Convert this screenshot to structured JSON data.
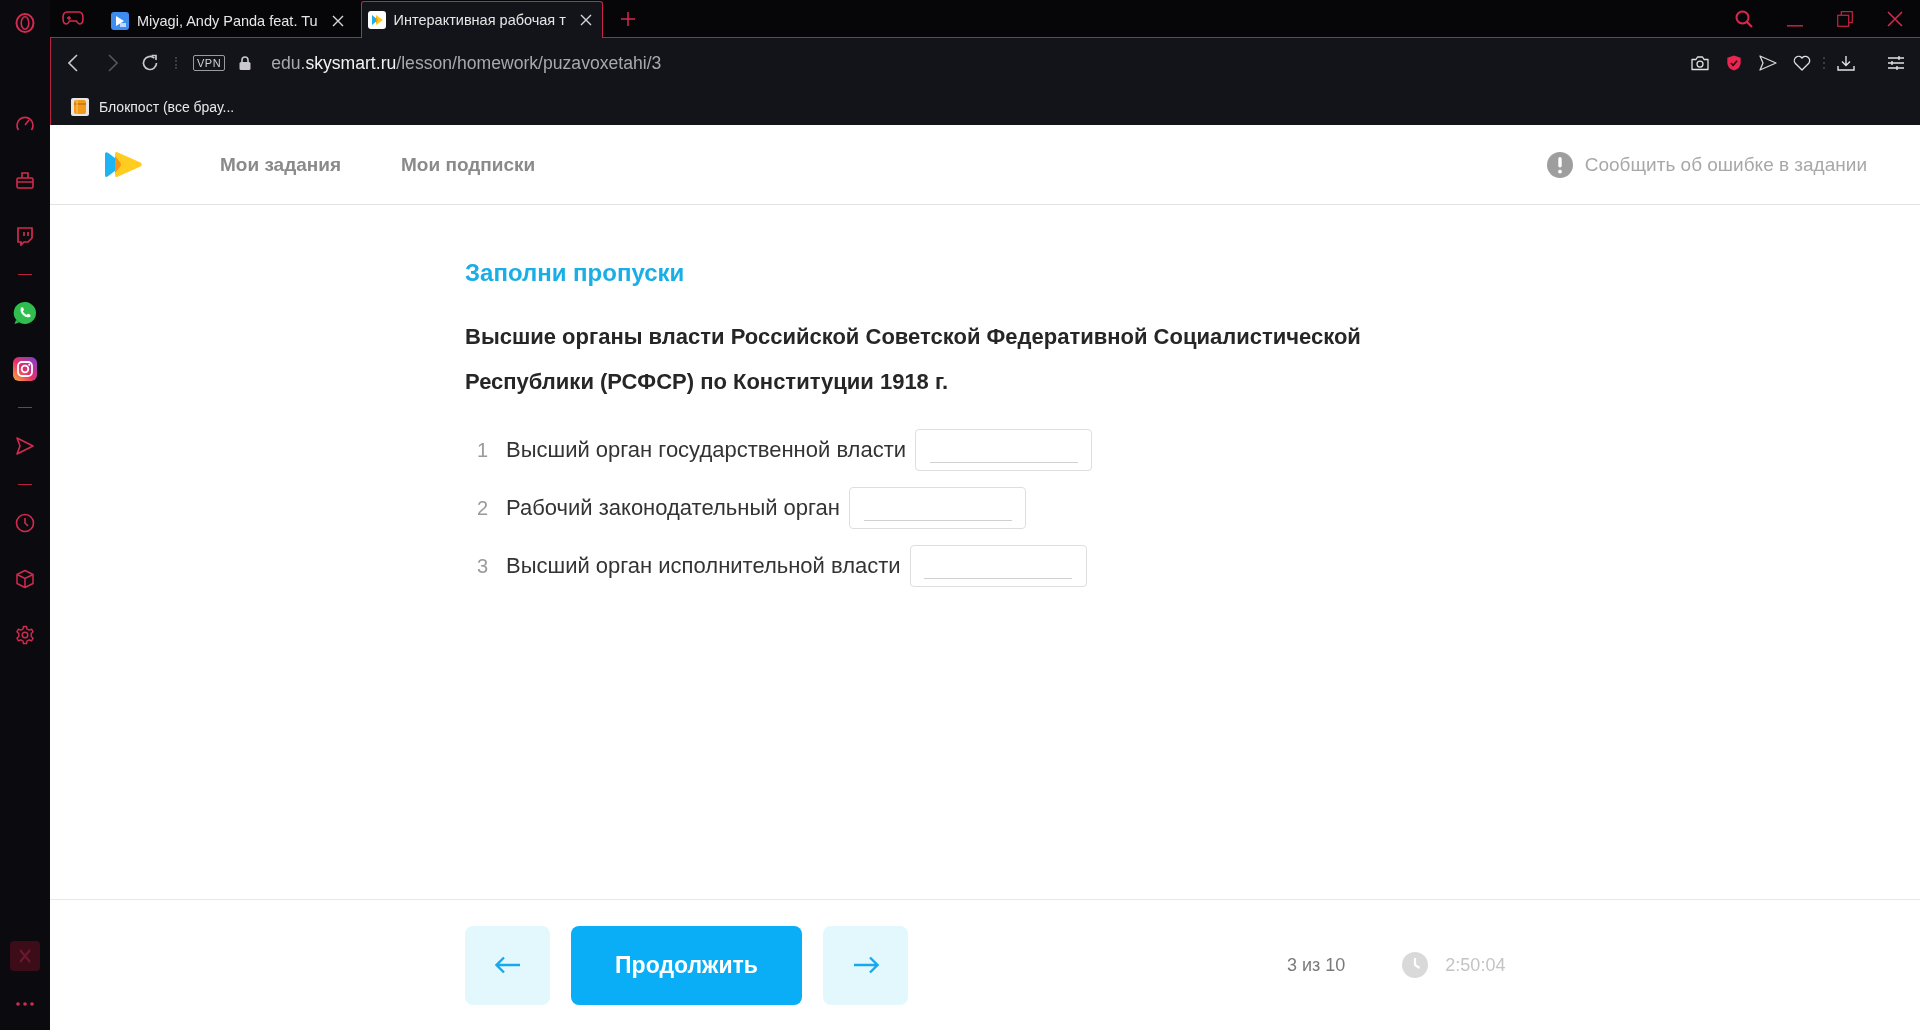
{
  "browser": {
    "tabs": [
      {
        "title": "Miyagi, Andy Panda feat. Tu",
        "selected": false
      },
      {
        "title": "Интерактивная рабочая т",
        "selected": true
      }
    ],
    "vpn_label": "VPN",
    "url": [
      {
        "text": "edu.",
        "highlight": false
      },
      {
        "text": "skysmart.ru",
        "highlight": true
      },
      {
        "text": "/lesson/homework/puzavoxetahi/3",
        "highlight": false
      }
    ],
    "bookmarks": [
      {
        "title": "Блокпост (все брау..."
      }
    ]
  },
  "site": {
    "nav": [
      {
        "label": "Мои задания"
      },
      {
        "label": "Мои подписки"
      }
    ],
    "report_link": "Сообщить об ошибке в задании"
  },
  "task": {
    "heading": "Заполни пропуски",
    "question": "Высшие органы власти Российской Советской Федеративной Социалистической Республики (РСФСР) по Конституции 1918 г.",
    "items": [
      {
        "number": "1",
        "text": "Высший орган государственной власти"
      },
      {
        "number": "2",
        "text": "Рабочий законодательный орган"
      },
      {
        "number": "3",
        "text": "Высший орган исполнительной власти"
      }
    ]
  },
  "footer": {
    "continue_label": "Продолжить",
    "progress": "3 из 10",
    "timer": "2:50:04"
  }
}
